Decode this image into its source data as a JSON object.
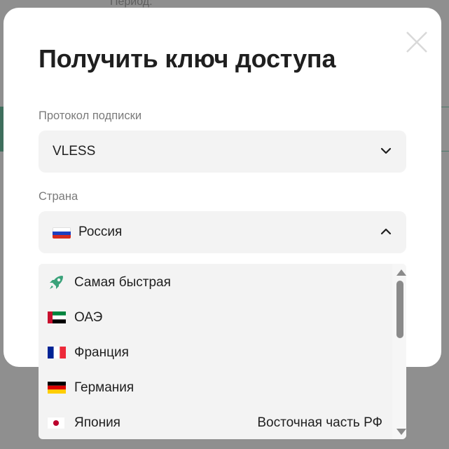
{
  "background": {
    "period_label": "Период:"
  },
  "modal": {
    "title": "Получить ключ доступа",
    "close_icon": "close-icon"
  },
  "protocol": {
    "label": "Протокол подписки",
    "value": "VLESS",
    "state": "collapsed"
  },
  "country": {
    "label": "Страна",
    "value": "Россия",
    "flag": "russia-flag-icon",
    "state": "expanded"
  },
  "dropdown": {
    "options": [
      {
        "label": "Самая быстрая",
        "icon": "rocket-icon"
      },
      {
        "label": "ОАЭ",
        "icon": "uae-flag-icon"
      },
      {
        "label": "Франция",
        "icon": "france-flag-icon"
      },
      {
        "label": "Германия",
        "icon": "germany-flag-icon"
      },
      {
        "label": "Япония",
        "icon": "japan-flag-icon"
      }
    ],
    "partial_text": "Восточная часть РФ"
  },
  "colors": {
    "accent_green": "#3aa27a",
    "overlay": "#8f8f8f",
    "field_bg": "#f3f3f3"
  }
}
